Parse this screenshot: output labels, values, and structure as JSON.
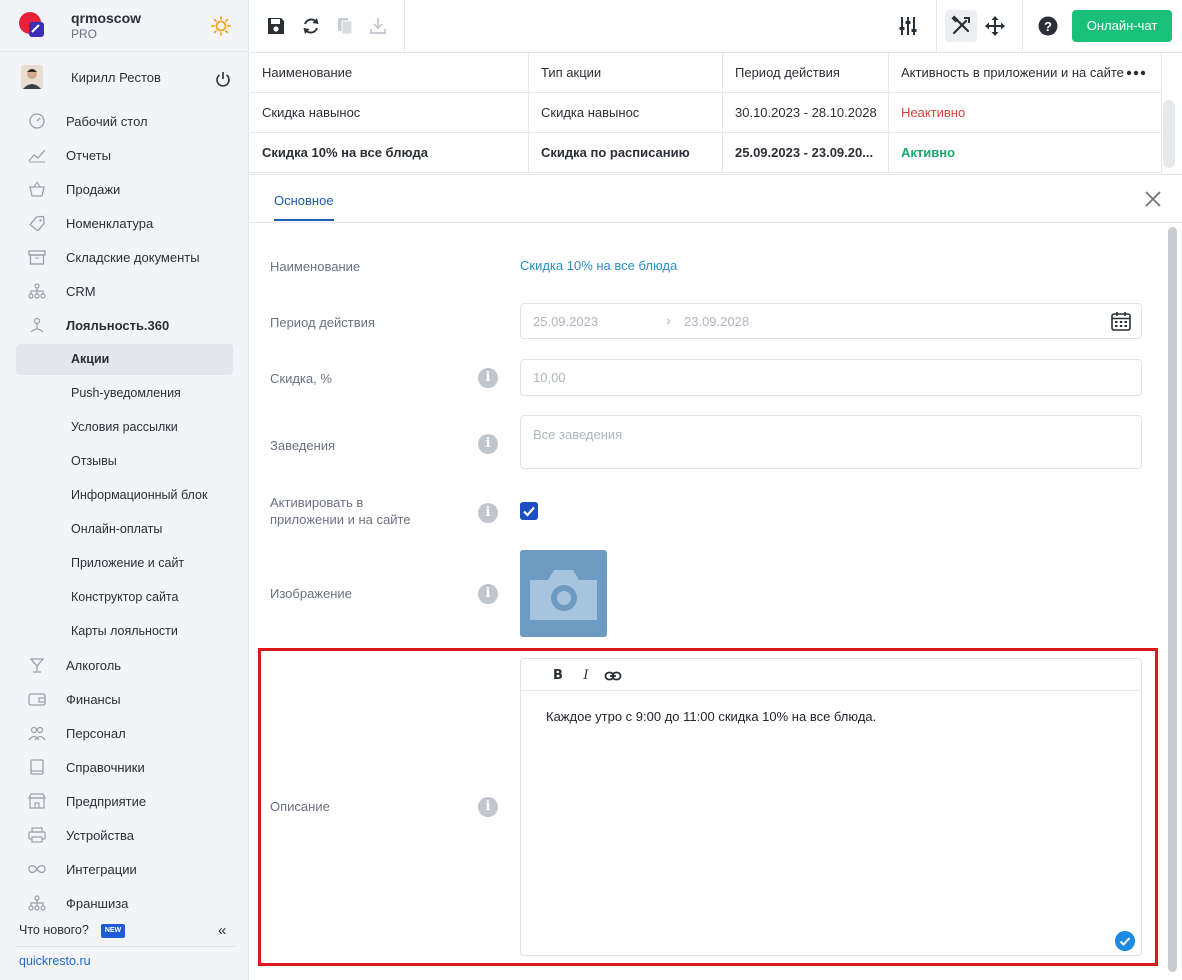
{
  "brand": {
    "name": "qrmoscow",
    "plan": "PRO",
    "logo_icon": "brand-logo-icon",
    "theme_icon": "sun-icon"
  },
  "user": {
    "name": "Кирилл Рестов"
  },
  "sidebar": {
    "items": [
      {
        "label": "Рабочий стол",
        "icon": "dashboard-icon"
      },
      {
        "label": "Отчеты",
        "icon": "chart-icon"
      },
      {
        "label": "Продажи",
        "icon": "basket-icon"
      },
      {
        "label": "Номенклатура",
        "icon": "tag-icon"
      },
      {
        "label": "Складские документы",
        "icon": "box-icon"
      },
      {
        "label": "CRM",
        "icon": "org-icon"
      },
      {
        "label": "Лояльность.360",
        "icon": "loyalty-icon"
      }
    ],
    "subitems": [
      {
        "label": "Акции",
        "active": true
      },
      {
        "label": "Push-уведомления"
      },
      {
        "label": "Условия рассылки"
      },
      {
        "label": "Отзывы"
      },
      {
        "label": "Информационный блок"
      },
      {
        "label": "Онлайн-оплаты"
      },
      {
        "label": "Приложение и сайт"
      },
      {
        "label": "Конструктор сайта"
      },
      {
        "label": "Карты лояльности"
      }
    ],
    "items_after": [
      {
        "label": "Алкоголь",
        "icon": "glass-icon"
      },
      {
        "label": "Финансы",
        "icon": "wallet-icon"
      },
      {
        "label": "Персонал",
        "icon": "people-icon"
      },
      {
        "label": "Справочники",
        "icon": "book-icon"
      },
      {
        "label": "Предприятие",
        "icon": "store-icon"
      },
      {
        "label": "Устройства",
        "icon": "printer-icon"
      },
      {
        "label": "Интеграции",
        "icon": "infinity-icon"
      },
      {
        "label": "Франшиза",
        "icon": "org-icon"
      }
    ],
    "whats_new": "Что нового?",
    "new_badge": "NEW",
    "site_link": "quickresto.ru"
  },
  "toolbar": {
    "chat_button": "Онлайн-чат"
  },
  "table": {
    "headers": [
      "Наименование",
      "Тип акции",
      "Период действия",
      "Активность в приложении и на сайте"
    ],
    "rows": [
      {
        "name": "Скидка навынос",
        "type": "Скидка навынос",
        "period": "30.10.2023 - 28.10.2028",
        "status": "Неактивно",
        "active": false
      },
      {
        "name": "Скидка 10% на все блюда",
        "type": "Скидка по расписанию",
        "period": "25.09.2023 - 23.09.20...",
        "status": "Активно",
        "active": true
      }
    ]
  },
  "detail": {
    "tab": "Основное",
    "fields": {
      "name_label": "Наименование",
      "name_value": "Скидка 10% на все блюда",
      "period_label": "Период действия",
      "period_from": "25.09.2023",
      "period_to": "23.09.2028",
      "discount_label": "Скидка, %",
      "discount_value": "10,00",
      "venues_label": "Заведения",
      "venues_placeholder": "Все заведения",
      "activate_label": "Активировать в приложении и на сайте",
      "activate_checked": true,
      "image_label": "Изображение",
      "description_label": "Описание",
      "description_value": "Каждое утро с 9:00 до 11:00 скидка 10% на все блюда."
    },
    "editor_buttons": {
      "bold": "B",
      "italic": "I"
    }
  },
  "colors": {
    "accent": "#1e5bb4",
    "chat": "#18c07a",
    "active": "#17a86a",
    "inactive": "#d9453b",
    "highlight": "#e0171a"
  }
}
